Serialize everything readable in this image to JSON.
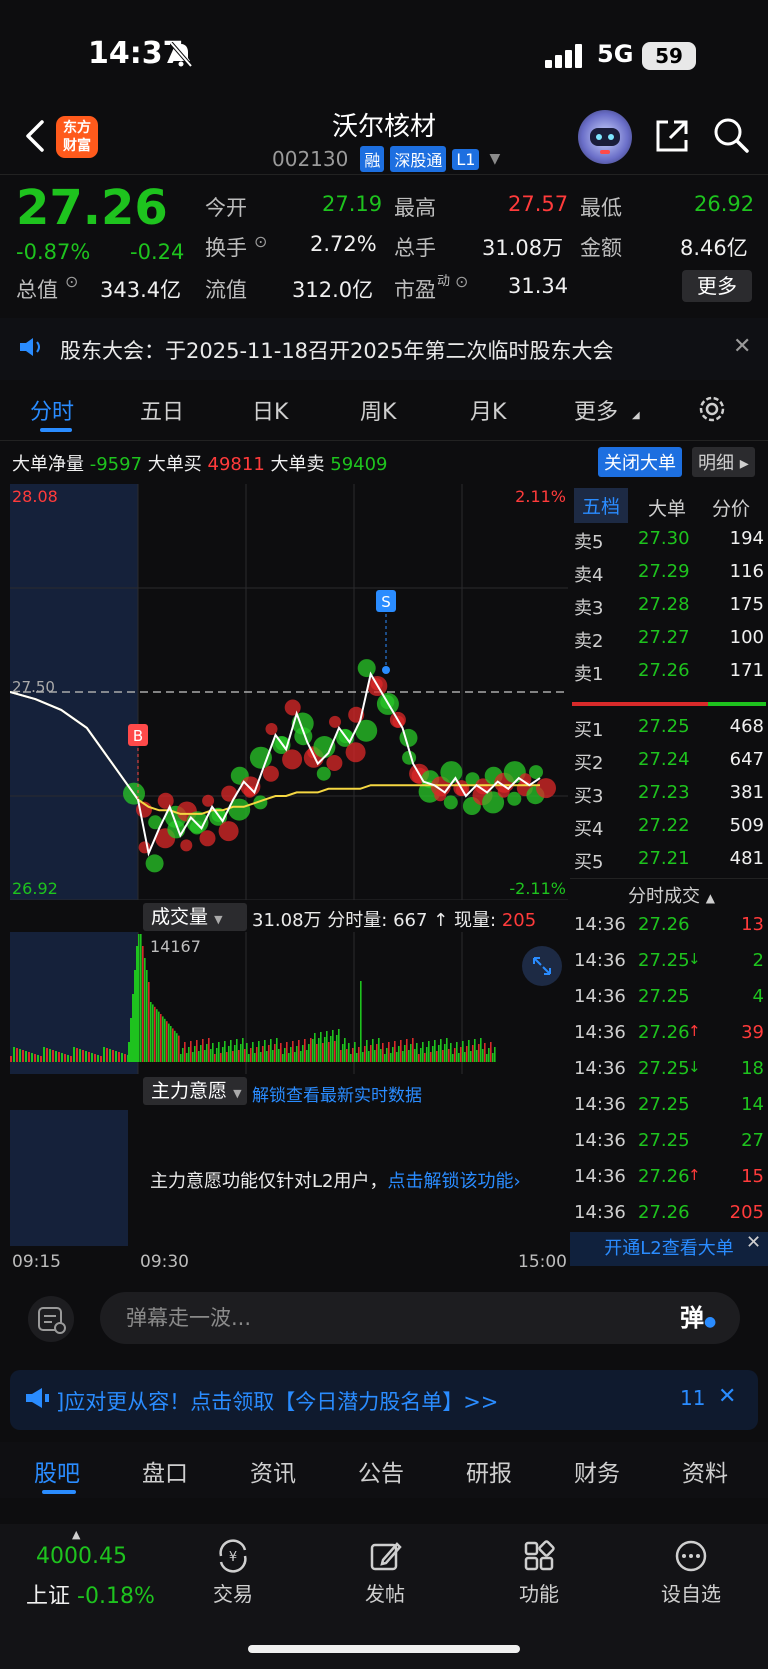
{
  "status_bar": {
    "time": "14:37",
    "network": "5G",
    "battery": "59"
  },
  "header": {
    "logo": "东方\n财富",
    "name": "沃尔核材",
    "code": "002130",
    "tags": [
      "融",
      "深股通",
      "L1"
    ]
  },
  "quote": {
    "price": "27.26",
    "change_pct": "-0.87%",
    "change": "-0.24",
    "open_label": "今开",
    "open": "27.19",
    "high_label": "最高",
    "high": "27.57",
    "low_label": "最低",
    "low": "26.92",
    "turnover_label": "换手",
    "turnover": "2.72%",
    "volume_label": "总手",
    "volume": "31.08万",
    "amount_label": "金额",
    "amount": "8.46亿",
    "mktcap_label": "总值",
    "mktcap": "343.4亿",
    "float_label": "流值",
    "float": "312.0亿",
    "pe_label": "市盈",
    "pe_sup": "动",
    "pe": "31.34",
    "more": "更多"
  },
  "notice": {
    "text": "股东大会：于2025-11-18召开2025年第二次临时股东大会"
  },
  "tabs": [
    "分时",
    "五日",
    "日K",
    "周K",
    "月K",
    "更多"
  ],
  "big_orders": {
    "net_label": "大单净量",
    "net": "-9597",
    "buy_label": "大单买",
    "buy": "49811",
    "sell_label": "大单卖",
    "sell": "59409",
    "close_btn": "关闭大单",
    "detail_btn": "明细"
  },
  "chart_labels": {
    "top_price": "28.08",
    "bottom_price": "26.92",
    "top_pct": "2.11%",
    "bottom_pct": "-2.11%",
    "mid_price": "27.50",
    "b_mark": "B",
    "s_mark": "S"
  },
  "chart_data": {
    "type": "line",
    "ylim": [
      26.92,
      28.08
    ],
    "reference_price": 27.5,
    "x": [
      0,
      0.04,
      0.08,
      0.12,
      0.16,
      0.2,
      0.22,
      0.24,
      0.26,
      0.28,
      0.3,
      0.32,
      0.34,
      0.36,
      0.38,
      0.4,
      0.42,
      0.44,
      0.46,
      0.48,
      0.5,
      0.52,
      0.54,
      0.56,
      0.58,
      0.6,
      0.62,
      0.64,
      0.66,
      0.68,
      0.7,
      0.72,
      0.74,
      0.76,
      0.78,
      0.8,
      0.82,
      0.84,
      0.86,
      0.88,
      0.9,
      0.92,
      0.94,
      0.96
    ],
    "series": [
      {
        "values": [
          27.5,
          27.48,
          27.45,
          27.4,
          27.3,
          27.2,
          27.05,
          27.12,
          27.18,
          27.1,
          27.15,
          27.12,
          27.18,
          27.14,
          27.2,
          27.25,
          27.22,
          27.3,
          27.38,
          27.34,
          27.44,
          27.36,
          27.3,
          27.33,
          27.4,
          27.36,
          27.42,
          27.55,
          27.5,
          27.45,
          27.4,
          27.3,
          27.25,
          27.24,
          27.22,
          27.26,
          27.21,
          27.24,
          27.22,
          27.25,
          27.23,
          27.26,
          27.24,
          27.26
        ]
      },
      {
        "values": [
          27.5,
          27.48,
          27.45,
          27.4,
          27.3,
          27.2,
          27.18,
          27.17,
          27.17,
          27.16,
          27.16,
          27.16,
          27.17,
          27.17,
          27.18,
          27.18,
          27.19,
          27.2,
          27.21,
          27.21,
          27.22,
          27.22,
          27.22,
          27.23,
          27.23,
          27.23,
          27.23,
          27.24,
          27.24,
          27.24,
          27.24,
          27.24,
          27.24,
          27.24,
          27.24,
          27.24,
          27.24,
          27.24,
          27.24,
          27.24,
          27.24,
          27.24,
          27.24,
          27.24
        ]
      }
    ]
  },
  "volume": {
    "label": "成交量",
    "total": "31.08万",
    "min_label": "分时量:",
    "min": "667",
    "cur_label": "现量:",
    "cur": "205",
    "max": "14167"
  },
  "zlyy": {
    "label": "主力意愿",
    "link": "解锁查看最新实时数据",
    "msg": "主力意愿功能仅针对L2用户，",
    "msg_link": "点击解锁该功能"
  },
  "time_axis": [
    "09:15",
    "09:30",
    "15:00"
  ],
  "order_book": {
    "tabs": [
      "五档",
      "大单",
      "分价"
    ],
    "asks": [
      {
        "label": "卖5",
        "price": "27.30",
        "vol": "194"
      },
      {
        "label": "卖4",
        "price": "27.29",
        "vol": "116"
      },
      {
        "label": "卖3",
        "price": "27.28",
        "vol": "175"
      },
      {
        "label": "卖2",
        "price": "27.27",
        "vol": "100"
      },
      {
        "label": "卖1",
        "price": "27.26",
        "vol": "171"
      }
    ],
    "bids": [
      {
        "label": "买1",
        "price": "27.25",
        "vol": "468"
      },
      {
        "label": "买2",
        "price": "27.24",
        "vol": "647"
      },
      {
        "label": "买3",
        "price": "27.23",
        "vol": "381"
      },
      {
        "label": "买4",
        "price": "27.22",
        "vol": "509"
      },
      {
        "label": "买5",
        "price": "27.21",
        "vol": "481"
      }
    ]
  },
  "trades": {
    "title": "分时成交",
    "rows": [
      {
        "time": "14:36",
        "price": "27.26",
        "arrow": "",
        "vol": "13",
        "vcolor": "red"
      },
      {
        "time": "14:36",
        "price": "27.25",
        "arrow": "↓",
        "vol": "2",
        "vcolor": "green"
      },
      {
        "time": "14:36",
        "price": "27.25",
        "arrow": "",
        "vol": "4",
        "vcolor": "green"
      },
      {
        "time": "14:36",
        "price": "27.26",
        "arrow": "↑",
        "vol": "39",
        "vcolor": "red"
      },
      {
        "time": "14:36",
        "price": "27.25",
        "arrow": "↓",
        "vol": "18",
        "vcolor": "green"
      },
      {
        "time": "14:36",
        "price": "27.25",
        "arrow": "",
        "vol": "14",
        "vcolor": "green"
      },
      {
        "time": "14:36",
        "price": "27.25",
        "arrow": "",
        "vol": "27",
        "vcolor": "green"
      },
      {
        "time": "14:36",
        "price": "27.26",
        "arrow": "↑",
        "vol": "15",
        "vcolor": "red"
      },
      {
        "time": "14:36",
        "price": "27.26",
        "arrow": "",
        "vol": "205",
        "vcolor": "red"
      }
    ],
    "banner": "开通L2查看大单"
  },
  "danmu": {
    "placeholder": "弹幕走一波...",
    "btn": "弹"
  },
  "promo": {
    "text": "]应对更从容！点击领取【今日潜力股名单】>>",
    "count": "11"
  },
  "bottom_tabs": [
    "股吧",
    "盘口",
    "资讯",
    "公告",
    "研报",
    "财务",
    "资料"
  ],
  "bottom_nav": {
    "index_value": "4000.45",
    "index_name": "上证",
    "index_change": "-0.18%",
    "items": [
      "交易",
      "发帖",
      "功能",
      "设自选"
    ]
  }
}
